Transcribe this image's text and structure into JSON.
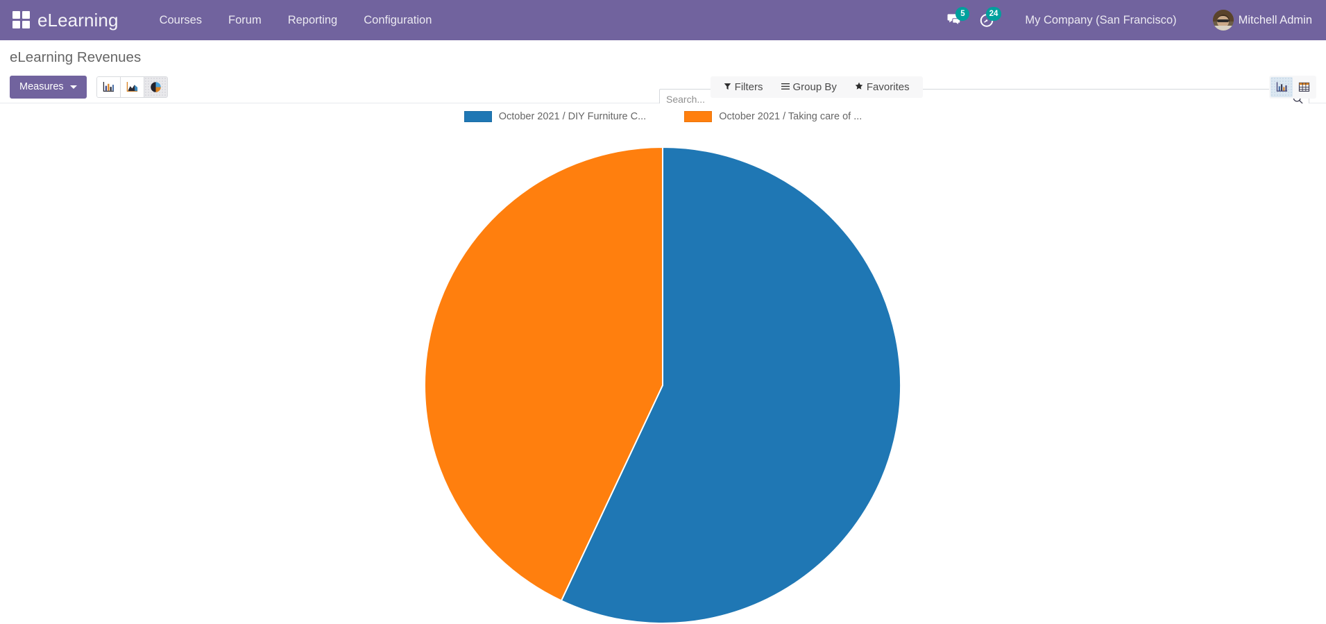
{
  "navbar": {
    "apps_icon": "apps-grid-icon",
    "brand": "eLearning",
    "menu": [
      {
        "label": "Courses"
      },
      {
        "label": "Forum"
      },
      {
        "label": "Reporting"
      },
      {
        "label": "Configuration"
      }
    ],
    "messages_badge": "5",
    "activities_badge": "24",
    "company": "My Company (San Francisco)",
    "user": "Mitchell Admin"
  },
  "control_panel": {
    "title": "eLearning Revenues",
    "measures_label": "Measures",
    "chart_buttons": [
      {
        "name": "bar-chart",
        "label": "Bar Chart",
        "active": false
      },
      {
        "name": "line-chart",
        "label": "Line Chart",
        "active": false
      },
      {
        "name": "pie-chart",
        "label": "Pie Chart",
        "active": true
      }
    ],
    "search": {
      "placeholder": "Search...",
      "value": ""
    },
    "filters": [
      {
        "label": "Filters",
        "icon": "filter-funnel-icon"
      },
      {
        "label": "Group By",
        "icon": "list-lines-icon"
      },
      {
        "label": "Favorites",
        "icon": "star-icon"
      }
    ],
    "view_switcher": [
      {
        "name": "graph-view",
        "label": "Graph",
        "active": true
      },
      {
        "name": "pivot-view",
        "label": "Pivot",
        "active": false
      }
    ]
  },
  "chart_data": {
    "type": "pie",
    "title": "eLearning Revenues",
    "labels": [
      "October 2021 / DIY Furniture C...",
      "October 2021 / Taking care of ..."
    ],
    "values": [
      57,
      43
    ],
    "colors": [
      "#1f77b4",
      "#ff7f0e"
    ],
    "legend_position": "top",
    "start_angle_deg": 0,
    "direction": "clockwise",
    "center": [
      955,
      555
    ],
    "radius": 343
  }
}
